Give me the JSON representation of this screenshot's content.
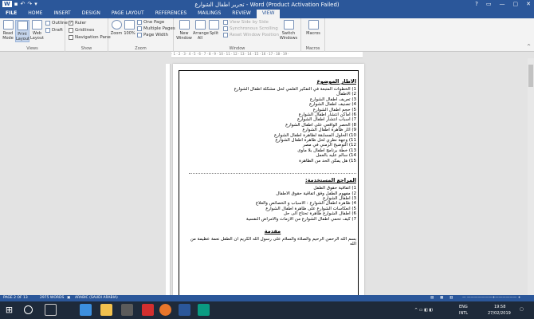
{
  "window": {
    "title": "تحرير اطفال الشوارع - Word (Product Activation Failed)",
    "qat": [
      "save",
      "undo",
      "redo"
    ],
    "controls": [
      "?",
      "▭",
      "—",
      "▢",
      "✕"
    ]
  },
  "tabs": [
    "FILE",
    "HOME",
    "INSERT",
    "DESIGN",
    "PAGE LAYOUT",
    "REFERENCES",
    "MAILINGS",
    "REVIEW",
    "VIEW"
  ],
  "active_tab": "VIEW",
  "ribbon": {
    "views": {
      "label": "Views",
      "read_mode": "Read Mode",
      "print_layout": "Print Layout",
      "web_layout": "Web Layout",
      "outline": "Outline",
      "draft": "Draft"
    },
    "show": {
      "label": "Show",
      "ruler": "Ruler",
      "gridlines": "Gridlines",
      "navigation_pane": "Navigation Pane"
    },
    "zoom": {
      "label": "Zoom",
      "zoom": "Zoom",
      "percent": "100%",
      "one_page": "One Page",
      "multiple_pages": "Multiple Pages",
      "page_width": "Page Width"
    },
    "window": {
      "label": "Window",
      "new_window": "New Window",
      "arrange_all": "Arrange All",
      "split": "Split",
      "view_side_by_side": "View Side by Side",
      "sync_scrolling": "Synchronous Scrolling",
      "reset_window": "Reset Window Position",
      "switch_windows": "Switch Windows"
    },
    "macros": {
      "label": "Macros",
      "macros": "Macros"
    }
  },
  "document": {
    "heading": "الاطار الموضوع",
    "items": [
      "1) الخطوات المتبعة في التفكير العلمي لحل مشكلة اطفال الشوارع",
      "2) الاطفال",
      "3) تعريف اطفال الشوارع",
      "4) تصنيف اطفال الشوارع",
      "5) حجم اطفال الشوارع",
      "6) اماكن انتشار اطفال الشوارع",
      "7) اسباب انتشار اطفال الشوارع",
      "8) الحصر الواقعي على اطفال الشوارع",
      "9) اثار ظاهرة اطفال الشوارع",
      "10) الحلول المسابقة لظاهرة اطفال الشوارع",
      "11) وجهة نظري لحل ظاهرة اطفال الشوارع",
      "12) التوضيح الزمني في مصر",
      "13) خطة برنامج اطفال بلا ماوى",
      "14) سالم عليه بالعمل",
      "15) هل يمكن الحد من الظاهرة"
    ],
    "references_heading": "المراجع المستخدمة:",
    "references": [
      "1) اتفاقية حقوق الطفل",
      "2) مفهوم الطفل وفق اتفاقية حقوق الاطفال",
      "3) اطفال الشوارع",
      "4) ظاهرة اطفال الشوارع : الاسباب و الخصائص والعلاج",
      "5) انعكاسات الشوارع على ظاهرة اطفال الشوارع",
      "6) اطفال الشوارع ظاهرة تحتاج الى حل",
      "7) كيف تحمي اطفال الشوارع من الازمات والامراض النفسية"
    ],
    "intro_heading": "مقدمة",
    "intro_text": "بسم الله الرحمن الرحيم والصلاة والسلام على رسول الله الكريم ان الطفل نعمة عظيمة من الله"
  },
  "statusbar": {
    "page": "PAGE 2 OF 13",
    "words": "2975 WORDS",
    "language": "ARABIC (SAUDI ARABIA)"
  },
  "taskbar": {
    "lang": "ENG",
    "region": "INTL",
    "time": "19:58",
    "date": "27/02/2019"
  },
  "colors": {
    "word_blue": "#2b579a",
    "taskbar": "#1e2a3a"
  }
}
